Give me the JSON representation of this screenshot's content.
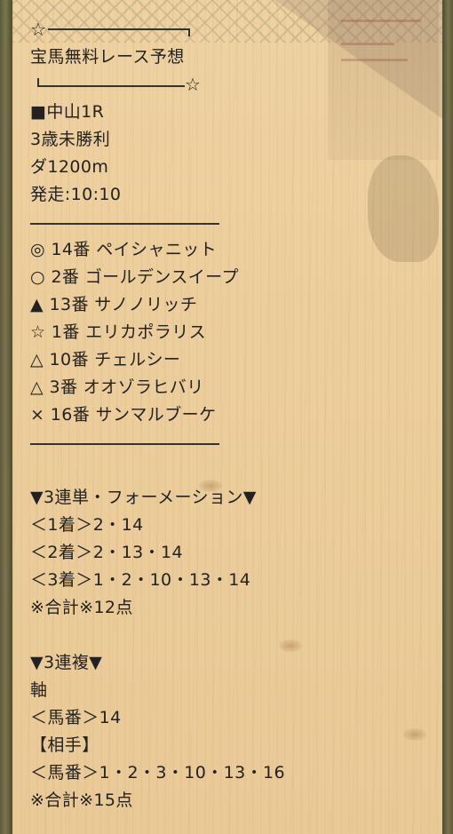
{
  "header": {
    "star": "☆",
    "title": "宝馬無料レース予想"
  },
  "race": {
    "venue": "■中山1R",
    "class": "3歳未勝利",
    "course": "ダ1200m",
    "start": "発走:10:10"
  },
  "picks": [
    {
      "mark": "◎",
      "text": "14番 ペイシャニット"
    },
    {
      "mark": "○",
      "text": "2番 ゴールデンスイープ"
    },
    {
      "mark": "▲",
      "text": "13番 サノノリッチ"
    },
    {
      "mark": "☆",
      "text": "1番 エリカポラリス"
    },
    {
      "mark": "△",
      "text": "10番 チェルシー"
    },
    {
      "mark": "△",
      "text": "3番 オオゾラヒバリ"
    },
    {
      "mark": "×",
      "text": "16番 サンマルブーケ"
    }
  ],
  "trifecta": {
    "heading": "▼3連単・フォーメーション▼",
    "lines": [
      "＜1着＞2・14",
      "＜2着＞2・13・14",
      "＜3着＞1・2・10・13・14"
    ],
    "total": "※合計※12点"
  },
  "trio": {
    "heading": "▼3連複▼",
    "axis_label": "軸",
    "axis": "＜馬番＞14",
    "partner_label": "【相手】",
    "partners": "＜馬番＞1・2・3・10・13・16",
    "total": "※合計※15点"
  }
}
